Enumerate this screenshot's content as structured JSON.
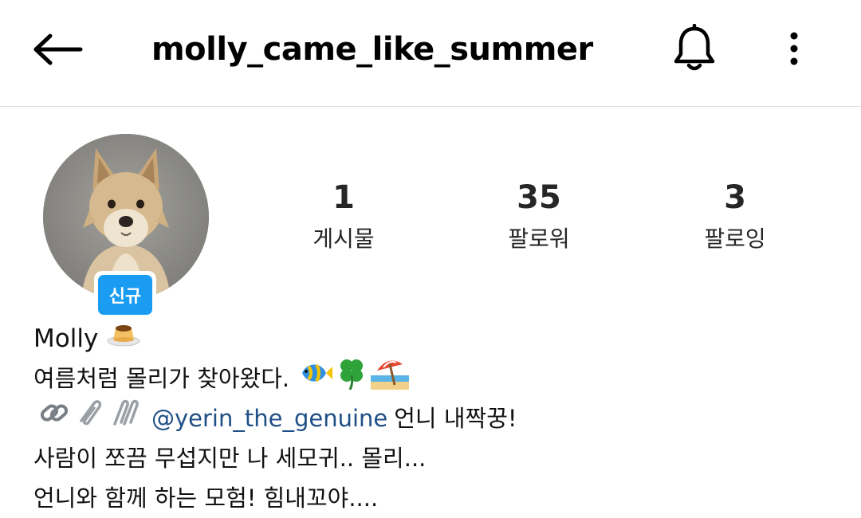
{
  "header": {
    "username": "molly_came_like_summer",
    "back_icon": "arrow-left-icon",
    "bell_icon": "bell-icon",
    "more_icon": "more-vertical-icon"
  },
  "profile": {
    "badge_label": "신규",
    "badge_color": "#1a9cf2"
  },
  "stats": {
    "posts": {
      "value": "1",
      "label": "게시물"
    },
    "followers": {
      "value": "35",
      "label": "팔로워"
    },
    "following": {
      "value": "3",
      "label": "팔로잉"
    }
  },
  "bio": {
    "name": "Molly",
    "name_emoji": "pudding-icon",
    "line1": "여름처럼 몰리가 찾아왔다.",
    "line1_emojis": [
      "tropical-fish-icon",
      "four-leaf-clover-icon",
      "beach-umbrella-icon"
    ],
    "line2_emojis": [
      "link-icon",
      "paperclip-icon",
      "linked-paperclips-icon"
    ],
    "mention": "@yerin_the_genuine",
    "line2_suffix": "언니 내짝꿍!",
    "line3": "사람이 쪼끔 무섭지만 나 세모귀.. 몰리...",
    "line4": "언니와 함께 하는 모험! 힘내꼬야....",
    "mention_color": "#1e4f86"
  }
}
